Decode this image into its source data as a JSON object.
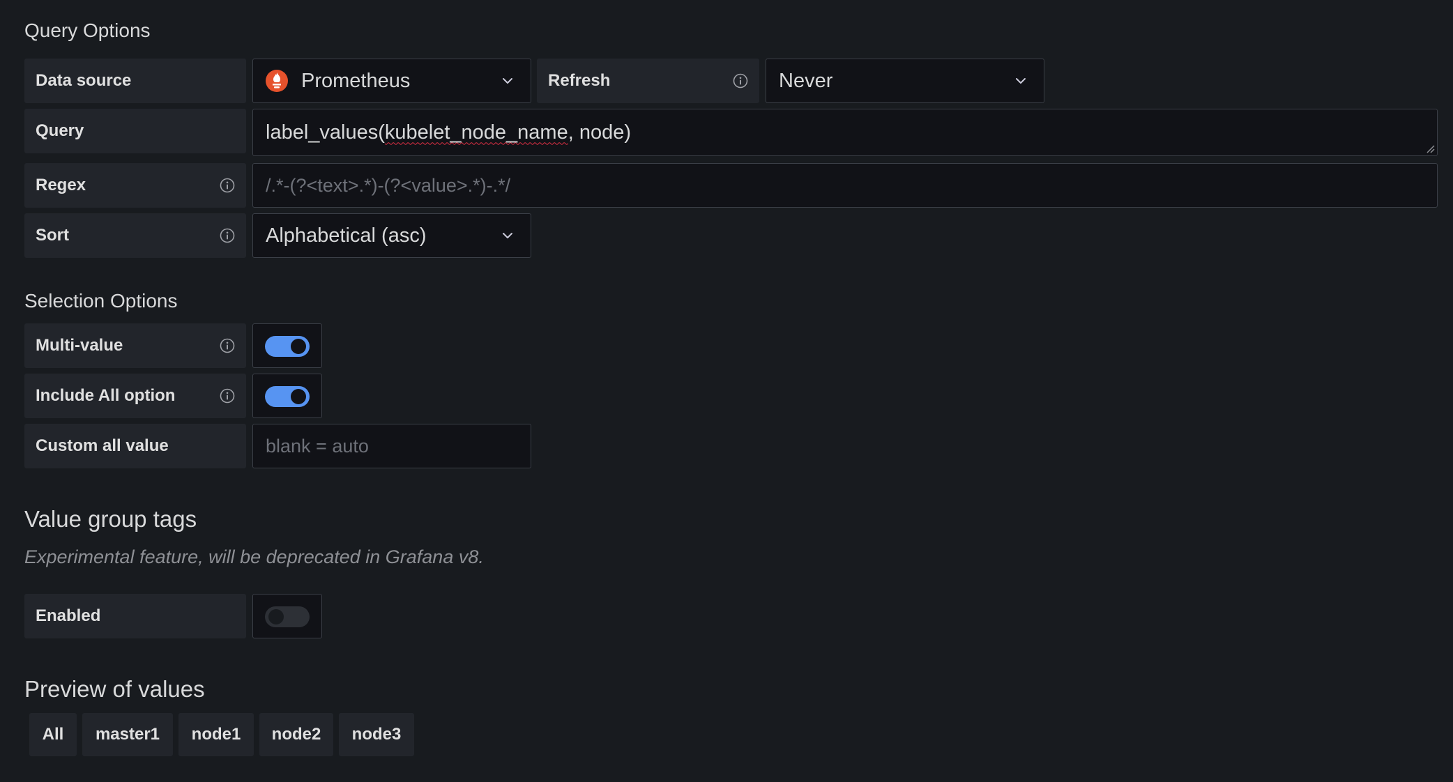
{
  "query_options": {
    "title": "Query Options",
    "data_source": {
      "label": "Data source",
      "value": "Prometheus",
      "icon": "prometheus-logo-icon",
      "icon_color": "#e6522c"
    },
    "refresh": {
      "label": "Refresh",
      "value": "Never"
    },
    "query": {
      "label": "Query",
      "value_prefix": "label_values(",
      "value_misspelled": "kubelet_node_name",
      "value_suffix": ", node)"
    },
    "regex": {
      "label": "Regex",
      "placeholder": "/.*-(?<text>.*)-(?<value>.*)-.*/"
    },
    "sort": {
      "label": "Sort",
      "value": "Alphabetical (asc)"
    }
  },
  "selection_options": {
    "title": "Selection Options",
    "multi_value": {
      "label": "Multi-value",
      "enabled": true
    },
    "include_all": {
      "label": "Include All option",
      "enabled": true
    },
    "custom_all_value": {
      "label": "Custom all value",
      "placeholder": "blank = auto"
    }
  },
  "value_group_tags": {
    "title": "Value group tags",
    "subtitle": "Experimental feature, will be deprecated in Grafana v8.",
    "enabled": {
      "label": "Enabled",
      "enabled": false
    }
  },
  "preview": {
    "title": "Preview of values",
    "values": [
      "All",
      "master1",
      "node1",
      "node2",
      "node3"
    ]
  },
  "colors": {
    "background": "#181b1f",
    "label_bg": "#22252b",
    "input_bg": "#111217",
    "accent": "#5794f2"
  }
}
